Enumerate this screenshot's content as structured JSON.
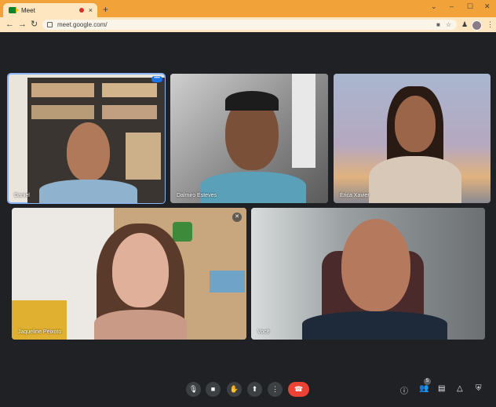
{
  "browser": {
    "tab_title": "Meet",
    "tab_close": "×",
    "new_tab": "+",
    "url": "meet.google.com/",
    "window_controls": [
      "⌄",
      "–",
      "☐",
      "✕"
    ]
  },
  "participants": [
    {
      "name": "Daniel",
      "speaking": true
    },
    {
      "name": "Dalmiro Esteves"
    },
    {
      "name": "Érica Xavier"
    },
    {
      "name": "Jaqueline Peixoto",
      "muted": true
    },
    {
      "name": "Você"
    }
  ],
  "controls": {
    "mic": "microphone-icon",
    "camera": "camera-icon",
    "hand": "raise-hand-icon",
    "present": "present-screen-icon",
    "more": "more-options-icon",
    "leave": "hang-up-icon"
  },
  "side_controls": {
    "participants_count": "5"
  },
  "colors": {
    "accent": "#8ab4f8",
    "hangup": "#ea4335",
    "background": "#202124",
    "tab_strip": "#f1a33a"
  }
}
